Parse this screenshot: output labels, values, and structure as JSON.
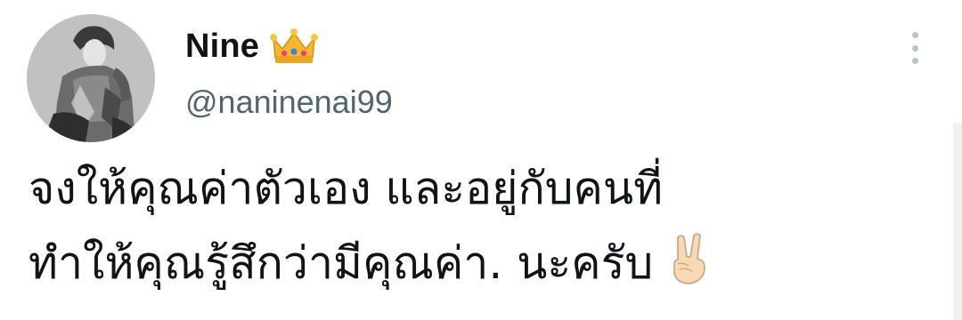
{
  "tweet": {
    "author": {
      "display_name": "Nine",
      "name_badge": "crown-emoji",
      "handle": "@naninenai99",
      "avatar_icon": "profile-photo-grayscale"
    },
    "more_menu_icon": "vertical-ellipsis",
    "text_lines": [
      "จงให้คุณค่าตัวเอง และอยู่กับคนที่",
      "ทำให้คุณรู้สึกว่ามีคุณค่า. นะครับ"
    ],
    "trailing_emoji": "victory-hand-emoji"
  },
  "colors": {
    "text_primary": "#0f1419",
    "text_secondary": "#536471",
    "icon_muted": "#b7c2cb",
    "background": "#ffffff"
  }
}
